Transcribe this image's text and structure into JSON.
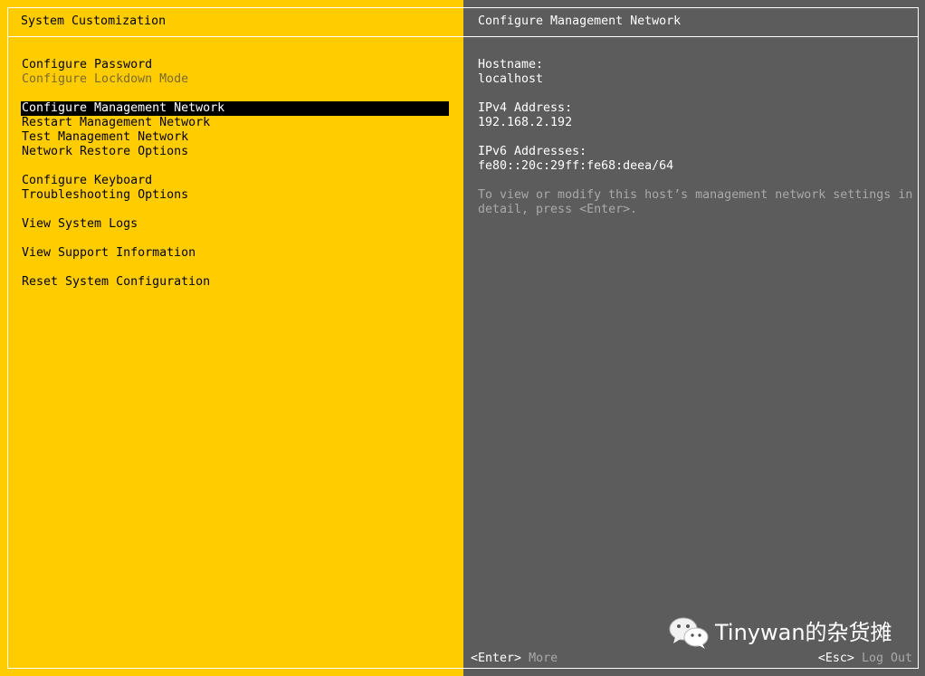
{
  "left": {
    "title": "System Customization",
    "menu": [
      {
        "label": "Configure Password",
        "state": "normal"
      },
      {
        "label": "Configure Lockdown Mode",
        "state": "disabled"
      },
      {
        "label": "Configure Management Network",
        "state": "selected"
      },
      {
        "label": "Restart Management Network",
        "state": "normal"
      },
      {
        "label": "Test Management Network",
        "state": "normal"
      },
      {
        "label": "Network Restore Options",
        "state": "normal"
      },
      {
        "label": "Configure Keyboard",
        "state": "normal"
      },
      {
        "label": "Troubleshooting Options",
        "state": "normal"
      },
      {
        "label": "View System Logs",
        "state": "normal"
      },
      {
        "label": "View Support Information",
        "state": "normal"
      },
      {
        "label": "Reset System Configuration",
        "state": "normal"
      }
    ]
  },
  "right": {
    "title": "Configure Management Network",
    "hostname_label": "Hostname:",
    "hostname_value": "localhost",
    "ipv4_label": "IPv4 Address:",
    "ipv4_value": "192.168.2.192",
    "ipv6_label": "IPv6 Addresses:",
    "ipv6_value": "fe80::20c:29ff:fe68:deea/64",
    "hint": "To view or modify this host’s management network settings in detail, press <Enter>."
  },
  "footer": {
    "enter_key": "<Enter>",
    "enter_action": "More",
    "esc_key": "<Esc>",
    "esc_action": "Log Out"
  },
  "watermark": {
    "text": "Tinywan的杂货摊",
    "icon": "wechat-icon"
  },
  "colors": {
    "left_bg": "#ffcc00",
    "right_bg": "#5c5c5c",
    "selection_bg": "#000000",
    "disabled_text": "#7a6a2e",
    "hint_text": "#a9a9a9"
  }
}
